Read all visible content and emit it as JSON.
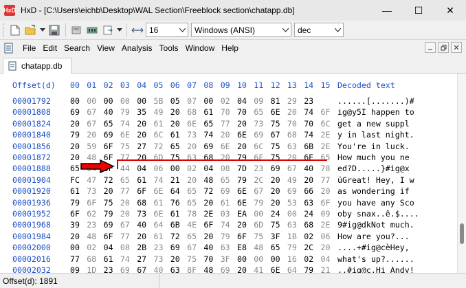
{
  "window": {
    "app_icon_text": "HxD",
    "title": "HxD - [C:\\Users\\eichb\\Desktop\\WAL Section\\Freeblock section\\chatapp.db]",
    "minimize": "—",
    "maximize": "☐",
    "close": "✕"
  },
  "toolbar": {
    "bytes_per_row": "16",
    "charset": "Windows (ANSI)",
    "offset_base": "dec"
  },
  "menu": {
    "items": [
      "File",
      "Edit",
      "Search",
      "View",
      "Analysis",
      "Tools",
      "Window",
      "Help"
    ]
  },
  "tab": {
    "label": "chatapp.db"
  },
  "hex": {
    "offset_header": "Offset(d)",
    "column_headers": [
      "00",
      "01",
      "02",
      "03",
      "04",
      "05",
      "06",
      "07",
      "08",
      "09",
      "10",
      "11",
      "12",
      "13",
      "14",
      "15"
    ],
    "decoded_header": "Decoded text",
    "rows": [
      {
        "offset": "00001792",
        "bytes": [
          "00",
          "00",
          "00",
          "00",
          "00",
          "5B",
          "05",
          "07",
          "00",
          "02",
          "04",
          "09",
          "81",
          "29",
          "23",
          ""
        ],
        "text": "......[.......)#"
      },
      {
        "offset": "00001808",
        "bytes": [
          "69",
          "67",
          "40",
          "79",
          "35",
          "49",
          "20",
          "68",
          "61",
          "70",
          "70",
          "65",
          "6E",
          "20",
          "74",
          "6F"
        ],
        "text": "ig@y5I happen to"
      },
      {
        "offset": "00001824",
        "bytes": [
          "20",
          "67",
          "65",
          "74",
          "20",
          "61",
          "20",
          "6E",
          "65",
          "77",
          "20",
          "73",
          "75",
          "70",
          "70",
          "6C"
        ],
        "text": " get a new suppl"
      },
      {
        "offset": "00001840",
        "bytes": [
          "79",
          "20",
          "69",
          "6E",
          "20",
          "6C",
          "61",
          "73",
          "74",
          "20",
          "6E",
          "69",
          "67",
          "68",
          "74",
          "2E"
        ],
        "text": "y in last night."
      },
      {
        "offset": "00001856",
        "bytes": [
          "20",
          "59",
          "6F",
          "75",
          "27",
          "72",
          "65",
          "20",
          "69",
          "6E",
          "20",
          "6C",
          "75",
          "63",
          "6B",
          "2E"
        ],
        "text": " You're in luck."
      },
      {
        "offset": "00001872",
        "bytes": [
          "20",
          "48",
          "6F",
          "77",
          "20",
          "6D",
          "75",
          "63",
          "68",
          "20",
          "79",
          "6F",
          "75",
          "20",
          "6E",
          "65"
        ],
        "text": " How much you ne"
      },
      {
        "offset": "00001888",
        "bytes": [
          "65",
          "64",
          "3F",
          "44",
          "04",
          "06",
          "00",
          "02",
          "04",
          "08",
          "7D",
          "23",
          "69",
          "67",
          "40",
          "78"
        ],
        "text": "ed?D.....}#ig@x"
      },
      {
        "offset": "00001904",
        "bytes": [
          "FC",
          "47",
          "72",
          "65",
          "61",
          "74",
          "21",
          "20",
          "48",
          "65",
          "79",
          "2C",
          "20",
          "49",
          "20",
          "77"
        ],
        "text": "üGreat! Hey, I w"
      },
      {
        "offset": "00001920",
        "bytes": [
          "61",
          "73",
          "20",
          "77",
          "6F",
          "6E",
          "64",
          "65",
          "72",
          "69",
          "6E",
          "67",
          "20",
          "69",
          "66",
          "20"
        ],
        "text": "as wondering if "
      },
      {
        "offset": "00001936",
        "bytes": [
          "79",
          "6F",
          "75",
          "20",
          "68",
          "61",
          "76",
          "65",
          "20",
          "61",
          "6E",
          "79",
          "20",
          "53",
          "63",
          "6F"
        ],
        "text": "you have any Sco"
      },
      {
        "offset": "00001952",
        "bytes": [
          "6F",
          "62",
          "79",
          "20",
          "73",
          "6E",
          "61",
          "78",
          "2E",
          "03",
          "EA",
          "00",
          "24",
          "00",
          "24",
          "09"
        ],
        "text": "oby snax..ê.$...."
      },
      {
        "offset": "00001968",
        "bytes": [
          "39",
          "23",
          "69",
          "67",
          "40",
          "64",
          "6B",
          "4E",
          "6F",
          "74",
          "20",
          "6D",
          "75",
          "63",
          "68",
          "2E"
        ],
        "text": "9#ig@dkNot much."
      },
      {
        "offset": "00001984",
        "bytes": [
          "20",
          "48",
          "6F",
          "77",
          "20",
          "61",
          "72",
          "65",
          "20",
          "79",
          "6F",
          "75",
          "3F",
          "1B",
          "02",
          "06"
        ],
        "text": " How are you?..."
      },
      {
        "offset": "00002000",
        "bytes": [
          "00",
          "02",
          "04",
          "08",
          "2B",
          "23",
          "69",
          "67",
          "40",
          "63",
          "E8",
          "48",
          "65",
          "79",
          "2C",
          "20"
        ],
        "text": "....+#ig@cèHey, "
      },
      {
        "offset": "00002016",
        "bytes": [
          "77",
          "68",
          "61",
          "74",
          "27",
          "73",
          "20",
          "75",
          "70",
          "3F",
          "00",
          "00",
          "00",
          "16",
          "02",
          "04"
        ],
        "text": "what's up?......"
      },
      {
        "offset": "00002032",
        "bytes": [
          "09",
          "1D",
          "23",
          "69",
          "67",
          "40",
          "63",
          "8F",
          "48",
          "69",
          "20",
          "41",
          "6E",
          "64",
          "79",
          "21"
        ],
        "text": "..#ig@c.Hi Andy!"
      }
    ]
  },
  "status": {
    "offset": "Offset(d): 1891"
  },
  "colors": {
    "offset_blue": "#1c50c8",
    "annotation_red": "#d00000"
  }
}
